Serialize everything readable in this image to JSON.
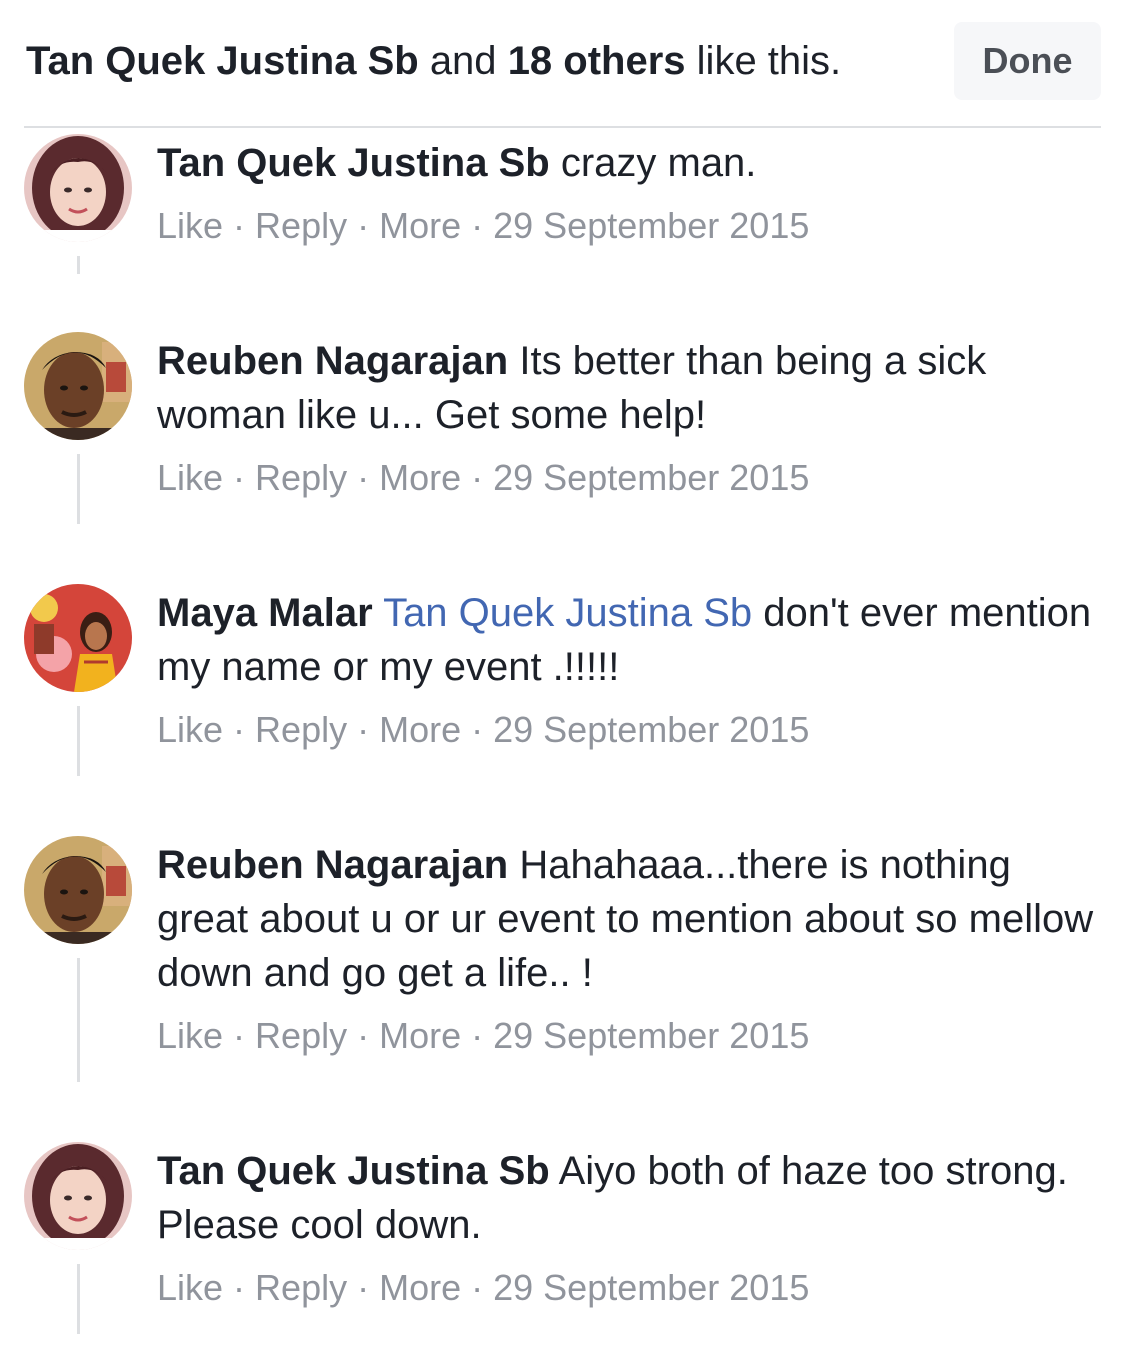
{
  "header": {
    "first_liker": "Tan Quek Justina Sb",
    "and_text": "and",
    "others_text": "18 others",
    "suffix_text": "like this.",
    "done_label": "Done"
  },
  "actions": {
    "like": "Like",
    "reply": "Reply",
    "more": "More",
    "separator": "·"
  },
  "comments": [
    {
      "author": "Tan Quek Justina Sb",
      "mention": "",
      "text": "crazy man.",
      "date": "29 September 2015"
    },
    {
      "author": "Reuben Nagarajan",
      "mention": "",
      "text": "Its better than being a sick woman like u... Get some help!",
      "date": "29 September 2015"
    },
    {
      "author": "Maya Malar",
      "mention": "Tan Quek Justina Sb",
      "text": "don't ever mention my name or my event .!!!!!",
      "date": "29 September 2015"
    },
    {
      "author": "Reuben Nagarajan",
      "mention": "",
      "text": "Hahahaaa...there is nothing great about u or ur event to mention about so mellow down and go get a life.. !",
      "date": "29 September 2015"
    },
    {
      "author": "Tan Quek Justina Sb",
      "mention": "",
      "text": "Aiyo both of haze too strong. Please cool down.",
      "date": "29 September 2015"
    }
  ],
  "colors": {
    "mention_link": "#4267b2",
    "meta_gray": "#90949c",
    "text_dark": "#1d2129",
    "done_bg": "#f6f7f9"
  }
}
